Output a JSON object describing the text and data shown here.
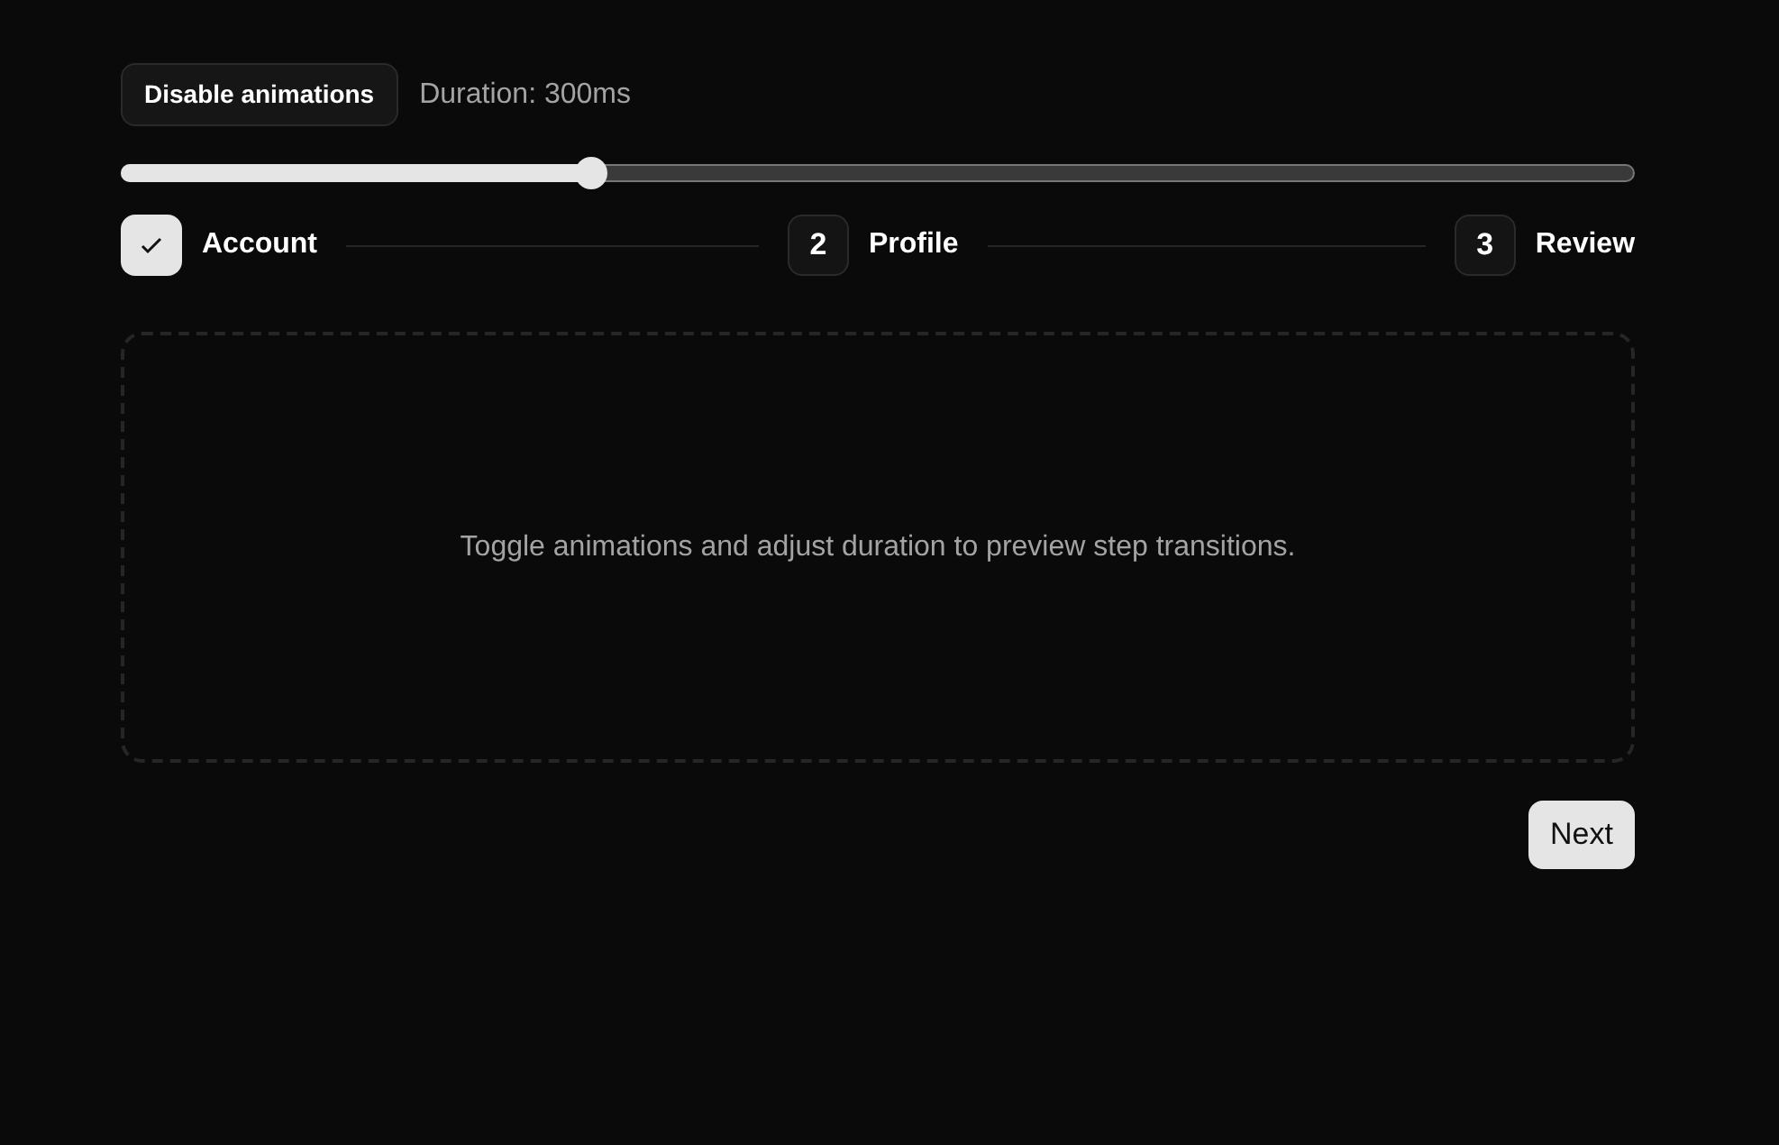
{
  "toggle_button": {
    "label": "Disable animations"
  },
  "duration": {
    "label": "Duration: 300ms",
    "level": 0.3
  },
  "steps": [
    {
      "label": "Account",
      "completed": true
    },
    {
      "number": "2",
      "label": "Profile",
      "completed": false
    },
    {
      "number": "3",
      "label": "Review",
      "completed": false
    }
  ],
  "panel": {
    "text": "Toggle animations and adjust duration to preview step transitions."
  },
  "next_button": {
    "label": "Next"
  }
}
